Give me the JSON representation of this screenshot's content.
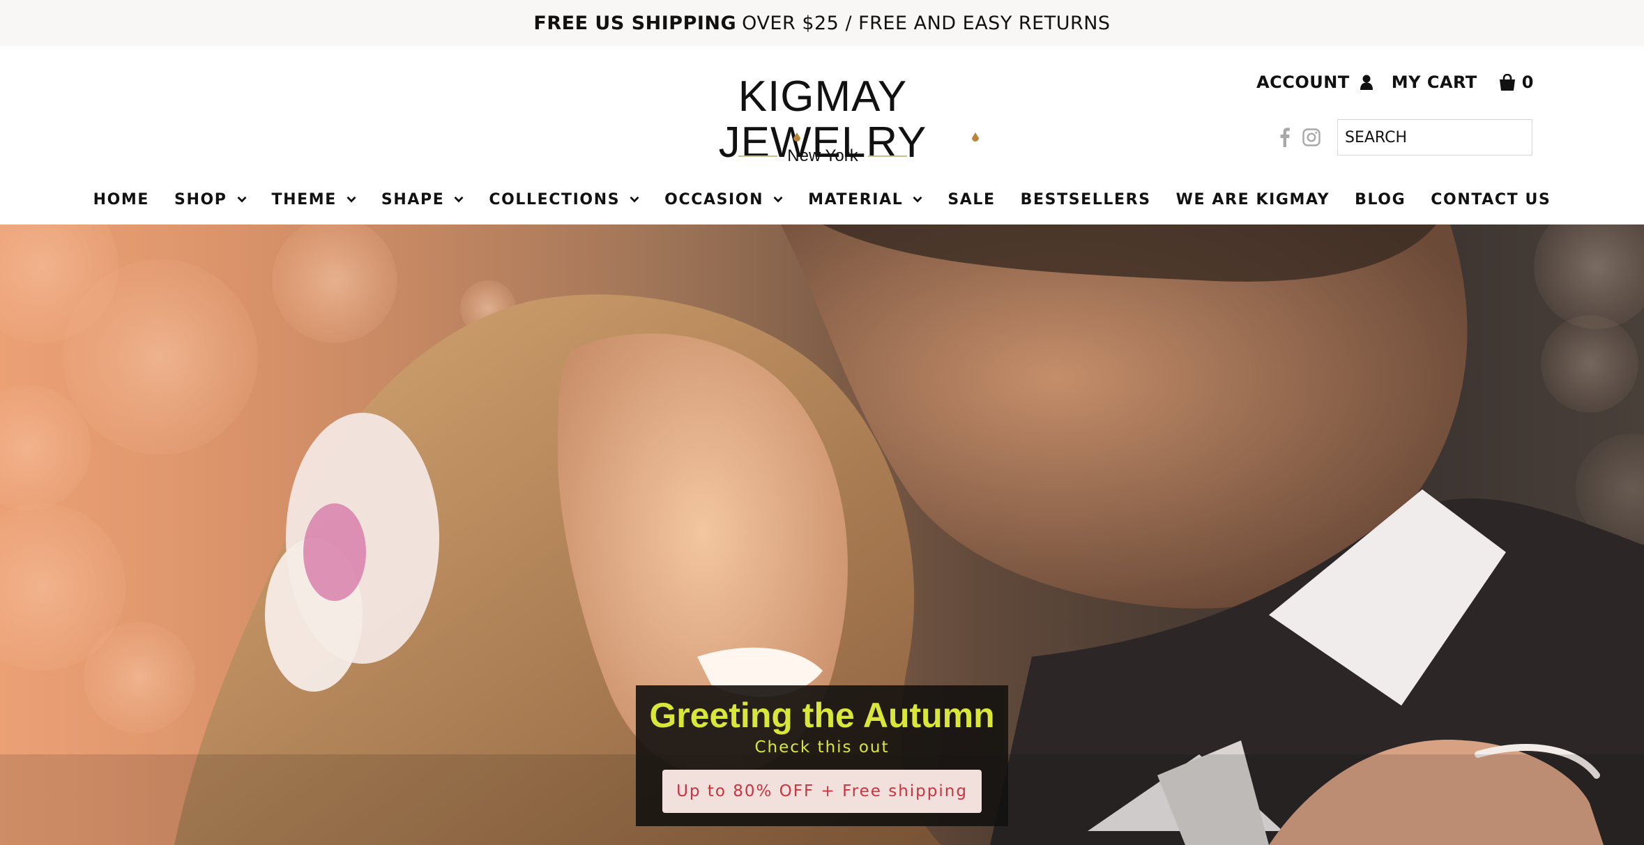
{
  "announcement": {
    "bold": "FREE US SHIPPING",
    "rest": "OVER $25 / FREE AND EASY RETURNS"
  },
  "logo": {
    "title": "KIGMAY JEWELRY",
    "subtitle": "New York"
  },
  "header": {
    "account_label": "ACCOUNT",
    "cart_label": "MY CART",
    "cart_count": "0",
    "search_placeholder": "SEARCH"
  },
  "social": {
    "icons": [
      "facebook-icon",
      "instagram-icon"
    ]
  },
  "nav": {
    "items": [
      {
        "label": "HOME",
        "dropdown": false
      },
      {
        "label": "SHOP",
        "dropdown": true
      },
      {
        "label": "THEME",
        "dropdown": true
      },
      {
        "label": "SHAPE",
        "dropdown": true
      },
      {
        "label": "COLLECTIONS",
        "dropdown": true
      },
      {
        "label": "OCCASION",
        "dropdown": true
      },
      {
        "label": "MATERIAL",
        "dropdown": true
      },
      {
        "label": "SALE",
        "dropdown": false
      },
      {
        "label": "BESTSELLERS",
        "dropdown": false
      },
      {
        "label": "WE ARE KIGMAY",
        "dropdown": false
      },
      {
        "label": "BLOG",
        "dropdown": false
      },
      {
        "label": "CONTACT US",
        "dropdown": false
      }
    ]
  },
  "hero": {
    "title": "Greeting the Autumn",
    "subtitle": "Check this out",
    "button_label": "Up to 80% OFF + Free shipping"
  },
  "colors": {
    "promo_title": "#d9e63a",
    "promo_button_text": "#c8343f",
    "promo_button_bg": "#f1e0dc",
    "announcement_bg": "#f8f7f5",
    "logo_accent": "#c8c08a"
  }
}
